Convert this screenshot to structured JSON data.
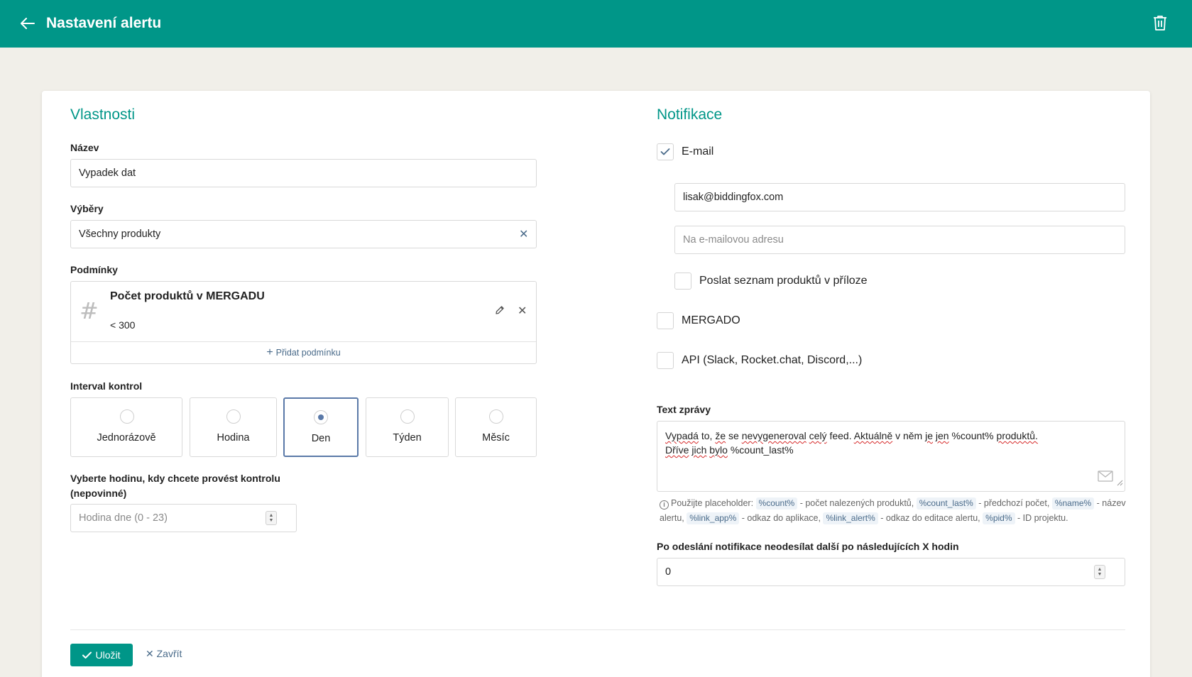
{
  "header": {
    "title": "Nastavení alertu",
    "bg_color": "#009688"
  },
  "properties": {
    "section_title": "Vlastnosti",
    "name_label": "Název",
    "name_value": "Vypadek dat",
    "selections_label": "Výběry",
    "selections_value": "Všechny produkty",
    "conditions_label": "Podmínky",
    "condition": {
      "name": "Počet produktů v MERGADU",
      "value": "< 300"
    },
    "add_condition_label": "Přidat podmínku",
    "interval_label": "Interval kontrol",
    "intervals": [
      {
        "label": "Jednorázově",
        "selected": false
      },
      {
        "label": "Hodina",
        "selected": false
      },
      {
        "label": "Den",
        "selected": true
      },
      {
        "label": "Týden",
        "selected": false
      },
      {
        "label": "Měsíc",
        "selected": false
      }
    ],
    "hour_label_line1": "Vyberte hodinu, kdy chcete provést kontrolu",
    "hour_label_line2": "(nepovinné)",
    "hour_placeholder": "Hodina dne (0 - 23)"
  },
  "notifications": {
    "section_title": "Notifikace",
    "email_label": "E-mail",
    "email_checked": true,
    "email_value": "lisak@biddingfox.com",
    "email_placeholder": "Na e-mailovou adresu",
    "attach_label": "Poslat seznam produktů v příloze",
    "mergado_label": "MERGADO",
    "api_label": "API (Slack, Rocket.chat, Discord,...)",
    "message_label": "Text zprávy",
    "message_line1": "Vypadá to, že se nevygeneroval celý feed. Aktuálně v něm je jen %count% produktů.",
    "message_line2": "Dříve jich bylo %count_last%",
    "help": {
      "intro": "Použijte placeholder:",
      "p1": "%count%",
      "d1": "- počet nalezených produktů,",
      "p2": "%count_last%",
      "d2": "- předchozí počet,",
      "p3": "%name%",
      "d3": "- název alertu,",
      "p4": "%link_app%",
      "d4": "- odkaz do aplikace,",
      "p5": "%link_alert%",
      "d5": "- odkaz do editace alertu,",
      "p6": "%pid%",
      "d6": "- ID projektu."
    },
    "throttle_label": "Po odeslání notifikace neodesílat další po následujících X hodin",
    "throttle_value": "0"
  },
  "footer": {
    "save_label": "Uložit",
    "close_label": "Zavřít"
  }
}
